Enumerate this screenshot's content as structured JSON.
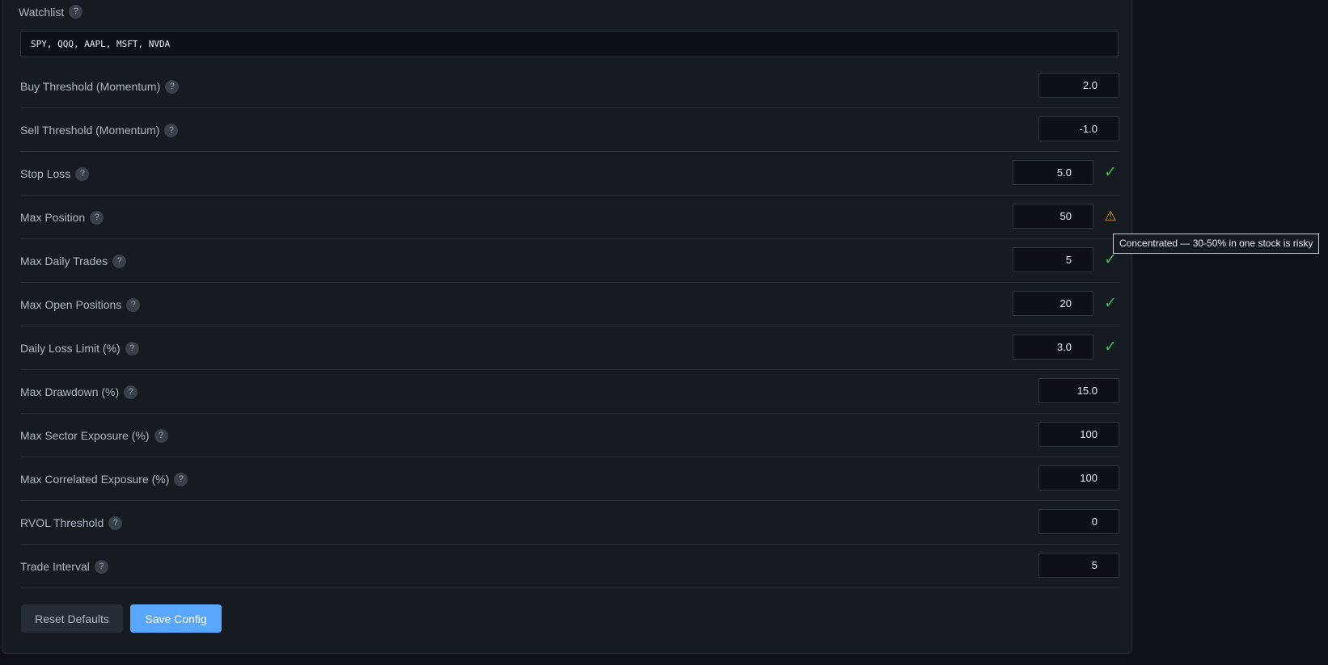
{
  "watchlist": {
    "label": "Watchlist",
    "help": "?",
    "value": "SPY, QQQ, AAPL, MSFT, NVDA"
  },
  "rows": [
    {
      "label": "Buy Threshold (Momentum)",
      "help": "?",
      "value": "2.0"
    },
    {
      "label": "Sell Threshold (Momentum)",
      "help": "?",
      "value": "-1.0"
    },
    {
      "label": "Stop Loss",
      "help": "?",
      "value": "5.0",
      "status": "✓",
      "status_kind": "ok"
    },
    {
      "label": "Max Position",
      "help": "?",
      "value": "50",
      "status": "⚠",
      "status_kind": "warning"
    },
    {
      "label": "Max Daily Trades",
      "help": "?",
      "value": "5",
      "status": "✓",
      "status_kind": "ok"
    },
    {
      "label": "Max Open Positions",
      "help": "?",
      "value": "20",
      "status": "✓",
      "status_kind": "ok"
    },
    {
      "label": "Daily Loss Limit (%)",
      "help": "?",
      "value": "3.0",
      "status": "✓",
      "status_kind": "ok"
    },
    {
      "label": "Max Drawdown (%)",
      "help": "?",
      "value": "15.0"
    },
    {
      "label": "Max Sector Exposure (%)",
      "help": "?",
      "value": "100"
    },
    {
      "label": "Max Correlated Exposure (%)",
      "help": "?",
      "value": "100"
    },
    {
      "label": "RVOL Threshold",
      "help": "?",
      "value": "0"
    },
    {
      "label": "Trade Interval",
      "help": "?",
      "value": "5"
    }
  ],
  "tooltip": {
    "text": "Concentrated — 30-50% in one stock is risky"
  },
  "buttons": {
    "reset_label": "Reset Defaults",
    "save_label": "Save Config"
  },
  "colors": {
    "background": "#0e1117",
    "panel": "#161b22",
    "ok": "#3fb950",
    "warning": "#d29922",
    "primary": "#58a6ff"
  },
  "icons": {
    "ok": "check-icon",
    "warning": "warning-icon",
    "help": "help-icon"
  }
}
